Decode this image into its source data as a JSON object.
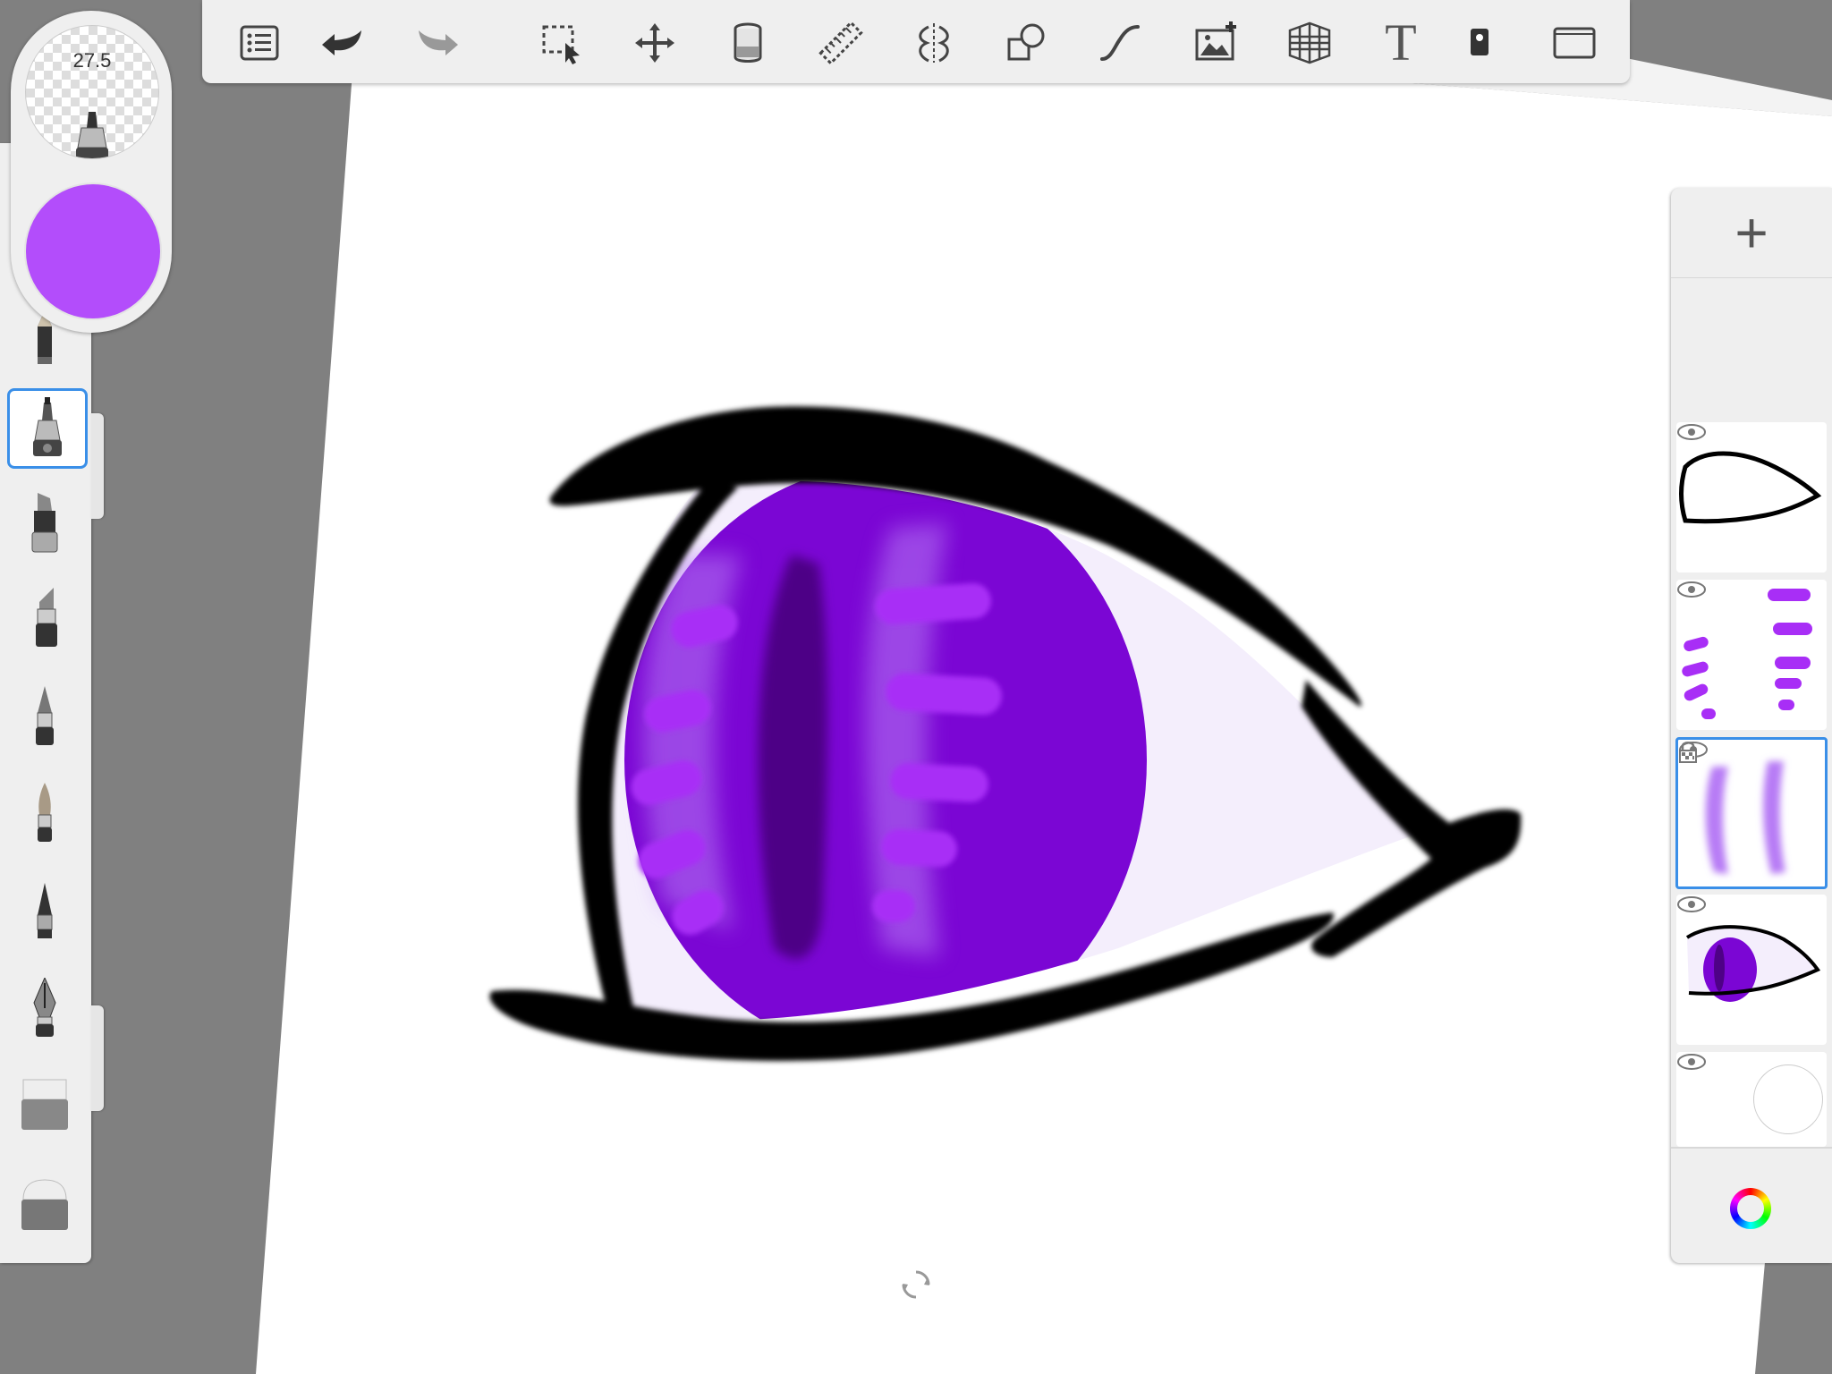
{
  "brush": {
    "size_label": "27.5",
    "color": "#b34dfb"
  },
  "toolbar": {
    "text_tool_glyph": "T",
    "icons": [
      "list-icon",
      "undo-icon",
      "redo-icon",
      "selection-icon",
      "transform-icon",
      "fill-bucket-icon",
      "ruler-icon",
      "symmetry-icon",
      "shape-icon",
      "curve-icon",
      "import-image-icon",
      "perspective-icon",
      "text-icon",
      "color-picker-icon",
      "fullscreen-icon"
    ]
  },
  "brushes": [
    "pencil",
    "ink-pen",
    "marker",
    "chisel-marker",
    "ballpoint",
    "paintbrush",
    "airbrush",
    "fountain-pen",
    "eraser-soft",
    "eraser-hard"
  ],
  "layers_panel": {
    "add_glyph": "+",
    "layers": [
      {
        "name": "outline-layer",
        "visible": true,
        "active": false
      },
      {
        "name": "highlights-layer",
        "visible": true,
        "active": false
      },
      {
        "name": "iris-shading-layer",
        "visible": true,
        "active": true,
        "locked": true
      },
      {
        "name": "color-layer",
        "visible": true,
        "active": false
      },
      {
        "name": "background-layer",
        "visible": true,
        "active": false
      }
    ]
  },
  "colors": {
    "accent": "#3a8fe8",
    "iris": "#7b06d4",
    "iris_dark": "#4e0186",
    "highlight": "#a82ef6",
    "sclera": "#f4eefc"
  }
}
